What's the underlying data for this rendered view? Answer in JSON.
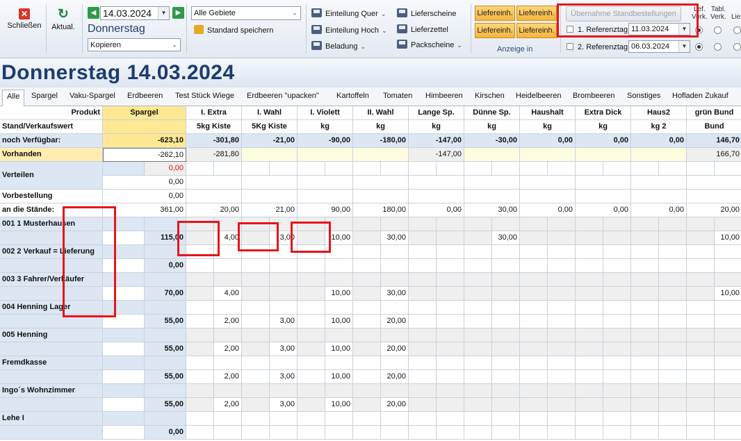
{
  "toolbar": {
    "close_label": "Schließen",
    "refresh_label": "Aktual.",
    "date_value": "14.03.2024",
    "weekday": "Donnerstag",
    "copy_value": "Kopieren",
    "area_value": "Alle Gebiete",
    "save_standard_label": "Standard speichern",
    "einteilung_quer": "Einteilung Quer",
    "einteilung_hoch": "Einteilung Hoch",
    "beladung": "Beladung",
    "lieferscheine": "Lieferscheine",
    "lieferzettel": "Lieferzettel",
    "packscheine": "Packscheine",
    "lief_btn1": "Liefereinh.",
    "lief_btn2": "Liefereinh.",
    "lief_btn3": "Liefereinh.",
    "lief_btn4": "Liefereinh.",
    "anzeige_label": "Anzeige in",
    "uebernahme_label": "Übernahme Standbestellungen",
    "ref1_label": "1. Referenztag",
    "ref1_value": "11.03.2024",
    "ref2_label": "2. Referenztag",
    "ref2_value": "06.03.2024",
    "col_head1": "Lef.",
    "col_head1b": "Verk.",
    "col_head2": "Tabl.",
    "col_head2b": "Verk.",
    "col_head3": "Lie"
  },
  "page_title": "Donnerstag 14.03.2024",
  "tabs": [
    "Alle",
    "Spargel",
    "Vaku-Spargel",
    "Erdbeeren",
    "Test Stück Wiege",
    "Erdbeeren \"upacken\"",
    "Kartoffeln",
    "Tomaten",
    "Himbeeren",
    "Kirschen",
    "Heidelbeeren",
    "Brombeeren",
    "Sonstiges",
    "Hofladen Zukauf"
  ],
  "grid": {
    "label_produkt": "Produkt",
    "label_stand": "Stand/Verkaufswert",
    "label_noch": "noch Verfügbar:",
    "label_vorhanden": "Vorhanden",
    "label_verteilen": "Verteilen",
    "label_vorbestellung": "Vorbestellung",
    "label_staende": "an die Stände:",
    "products": [
      "Spargel",
      "I. Extra",
      "I. Wahl",
      "I. Violett",
      "II. Wahl",
      "Lange Sp.",
      "Dünne Sp.",
      "Haushalt",
      "Extra Dick",
      "Haus2",
      "grün Bund"
    ],
    "units": [
      "",
      "5kg Kiste",
      "5Kg Kiste",
      "kg",
      "kg",
      "kg",
      "kg",
      "kg",
      "kg",
      "kg 2",
      "Bund"
    ],
    "noch": [
      "-623,10",
      "-301,80",
      "-21,00",
      "-90,00",
      "-180,00",
      "-147,00",
      "-30,00",
      "0,00",
      "0,00",
      "0,00",
      "146,70"
    ],
    "vorhanden": {
      "spargel": "-262,10",
      "extra": "-281,80",
      "lange": "-147,00",
      "gruen": "166,70"
    },
    "verteilen": [
      "0,00",
      "0,00"
    ],
    "vorbestellung": "0,00",
    "staende": [
      "361,00",
      "20,00",
      "21,00",
      "90,00",
      "180,00",
      "0,00",
      "30,00",
      "0,00",
      "0,00",
      "0,00",
      "20,00"
    ],
    "stands": [
      {
        "name": "001 1 Musterhausen",
        "total": "115,00",
        "vals": [
          "4,00",
          "3,00",
          "10,00",
          "30,00",
          "",
          "30,00",
          "",
          "",
          "",
          "10,00"
        ]
      },
      {
        "name": "002 2 Verkauf = Lieferung",
        "total": "0,00",
        "vals": [
          "",
          "",
          "",
          "",
          "",
          "",
          "",
          "",
          "",
          ""
        ]
      },
      {
        "name": "003 3 Fahrer/Verkäufer",
        "total": "70,00",
        "vals": [
          "4,00",
          "",
          "10,00",
          "30,00",
          "",
          "",
          "",
          "",
          "",
          "10,00"
        ]
      },
      {
        "name": "004 Henning Lager",
        "total": "55,00",
        "vals": [
          "2,00",
          "3,00",
          "10,00",
          "20,00",
          "",
          "",
          "",
          "",
          "",
          ""
        ]
      },
      {
        "name": "005 Henning",
        "total": "55,00",
        "vals": [
          "2,00",
          "3,00",
          "10,00",
          "20,00",
          "",
          "",
          "",
          "",
          "",
          ""
        ]
      },
      {
        "name": "Fremdkasse",
        "total": "55,00",
        "vals": [
          "2,00",
          "3,00",
          "10,00",
          "20,00",
          "",
          "",
          "",
          "",
          "",
          ""
        ]
      },
      {
        "name": "Ingo´s Wohnzimmer",
        "total": "55,00",
        "vals": [
          "2,00",
          "3,00",
          "10,00",
          "20,00",
          "",
          "",
          "",
          "",
          "",
          ""
        ]
      },
      {
        "name": "Lehe I",
        "total": "0,00",
        "vals": [
          "",
          "",
          "",
          "",
          "",
          "",
          "",
          "",
          "",
          ""
        ]
      }
    ]
  },
  "colors": {
    "highlight_box": "#e8141a",
    "title": "#1e3c6d",
    "yellow": "#ffe893",
    "label_blue": "#dce7f3"
  }
}
